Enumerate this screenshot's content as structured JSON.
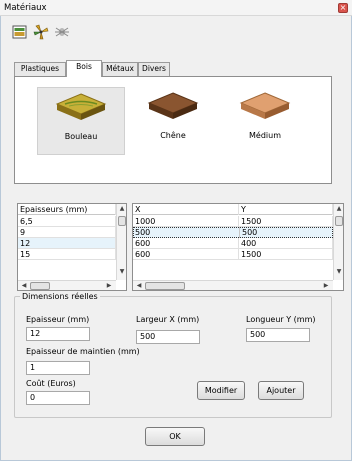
{
  "window": {
    "title": "Matériaux",
    "close_glyph": "×"
  },
  "toolbar": {
    "icons": [
      "materials-icon",
      "fan-icon",
      "bug-icon"
    ]
  },
  "tabs": [
    {
      "label": "Plastiques",
      "active": false
    },
    {
      "label": "Bois",
      "active": true
    },
    {
      "label": "Métaux",
      "active": false
    },
    {
      "label": "Divers",
      "active": false
    }
  ],
  "materials": [
    {
      "name": "Bouleau",
      "selected": true,
      "color": "#b8a030"
    },
    {
      "name": "Chêne",
      "selected": false,
      "color": "#7a4a2a"
    },
    {
      "name": "Médium",
      "selected": false,
      "color": "#d09060"
    }
  ],
  "thickness_table": {
    "header": "Epaisseurs (mm)",
    "rows": [
      "6,5",
      "9",
      "12",
      "15"
    ],
    "selected_index": 2
  },
  "dims_table": {
    "headers": [
      "X",
      "Y"
    ],
    "rows": [
      [
        "1000",
        "1500"
      ],
      [
        "500",
        "500"
      ],
      [
        "600",
        "400"
      ],
      [
        "600",
        "1500"
      ]
    ],
    "selected_index": 1
  },
  "dimensions": {
    "legend": "Dimensions réelles",
    "thickness_label": "Epaisseur (mm)",
    "thickness_value": "12",
    "width_label": "Largeur X (mm)",
    "width_value": "500",
    "length_label": "Longueur Y (mm)",
    "length_value": "500",
    "hold_label": "Epaisseur de maintien (mm)",
    "hold_value": "1",
    "cost_label": "Coût (Euros)",
    "cost_value": "0",
    "modify_label": "Modifier",
    "add_label": "Ajouter"
  },
  "ok_label": "OK",
  "scroll": {
    "up": "▲",
    "down": "▼",
    "left": "◀",
    "right": "▶"
  }
}
